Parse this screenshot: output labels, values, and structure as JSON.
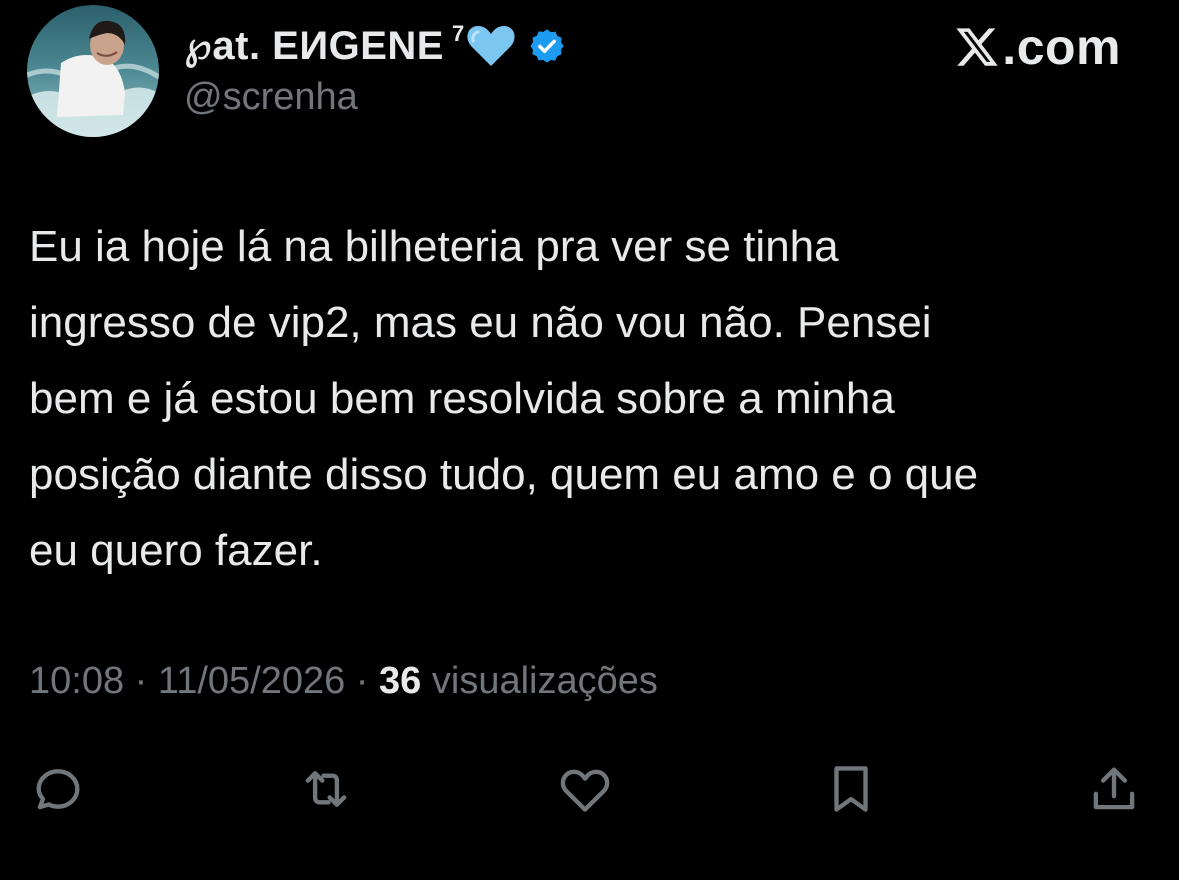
{
  "author": {
    "display_name": "℘at. EИGENE",
    "superscript": "7",
    "emoji_icon": "light-blue-heart-icon",
    "verified_icon": "verified-badge-icon",
    "handle": "@screnha",
    "avatar": "profile-avatar-photo"
  },
  "brand": {
    "logo_icon": "x-logo-icon",
    "text": ".com"
  },
  "tweet": {
    "text": "Eu ia hoje lá na bilheteria pra ver se tinha\ningresso de vip2, mas eu não vou não. Pensei\nbem e já estou bem resolvida sobre a minha\nposição diante disso tudo, quem eu amo e o que\neu quero fazer."
  },
  "meta": {
    "time": "10:08",
    "separator": " · ",
    "date": "11/05/2026",
    "views_count": "36",
    "views_label": " visualizações"
  },
  "actions": [
    {
      "icon": "reply-icon"
    },
    {
      "icon": "retweet-icon"
    },
    {
      "icon": "like-icon"
    },
    {
      "icon": "bookmark-icon"
    },
    {
      "icon": "share-icon"
    }
  ],
  "colors": {
    "background": "#000000",
    "primary_text": "#e7e9ea",
    "secondary_text": "#71767b",
    "verified_blue": "#1d9bf0",
    "heart_blue": "#7cc6f2"
  }
}
